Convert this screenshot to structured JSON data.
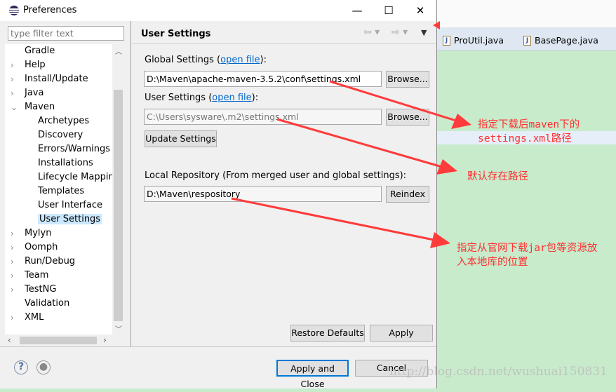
{
  "dialog": {
    "title": "Preferences",
    "minimize": "—",
    "maximize": "☐",
    "close": "✕"
  },
  "sidebar": {
    "filter_placeholder": "type filter text",
    "items": [
      {
        "label": "Gradle",
        "twisty": ""
      },
      {
        "label": "Help",
        "twisty": "›"
      },
      {
        "label": "Install/Update",
        "twisty": "›"
      },
      {
        "label": "Java",
        "twisty": "›"
      },
      {
        "label": "Maven",
        "twisty": "⌄"
      },
      {
        "label": "Archetypes",
        "child": true
      },
      {
        "label": "Discovery",
        "child": true
      },
      {
        "label": "Errors/Warnings",
        "child": true
      },
      {
        "label": "Installations",
        "child": true
      },
      {
        "label": "Lifecycle Mapping",
        "child": true
      },
      {
        "label": "Templates",
        "child": true
      },
      {
        "label": "User Interface",
        "child": true
      },
      {
        "label": "User Settings",
        "child": true,
        "selected": true
      },
      {
        "label": "Mylyn",
        "twisty": "›"
      },
      {
        "label": "Oomph",
        "twisty": "›"
      },
      {
        "label": "Run/Debug",
        "twisty": "›"
      },
      {
        "label": "Team",
        "twisty": "›"
      },
      {
        "label": "TestNG",
        "twisty": "›"
      },
      {
        "label": "Validation",
        "twisty": ""
      },
      {
        "label": "XML",
        "twisty": "›"
      }
    ]
  },
  "page": {
    "title": "User Settings",
    "global_label": "Global Settings (",
    "global_link": "open file",
    "global_suffix": "):",
    "global_value": "D:\\Maven\\apache-maven-3.5.2\\conf\\settings.xml",
    "user_label": "User Settings (",
    "user_link": "open file",
    "user_suffix": "):",
    "user_value": "C:\\Users\\sysware\\.m2\\settings.xml",
    "browse": "Browse...",
    "update": "Update Settings",
    "local_label": "Local Repository (From merged user and global settings):",
    "local_value": "D:\\Maven\\respository",
    "reindex": "Reindex",
    "restore": "Restore Defaults",
    "apply": "Apply"
  },
  "footer": {
    "apply_close": "Apply and Close",
    "cancel": "Cancel"
  },
  "ide": {
    "tabs": [
      "ProUtil.java",
      "BasePage.java"
    ]
  },
  "annotations": {
    "note1_line1": "指定下载后maven下的",
    "note1_line2": "settings.xml路径",
    "note2": "默认存在路径",
    "note3_line1": "指定从官网下载jar包等资源放",
    "note3_line2": "入本地库的位置",
    "color": "#ff3b3b"
  },
  "watermark": "http://blog.csdn.net/wushuai150831"
}
